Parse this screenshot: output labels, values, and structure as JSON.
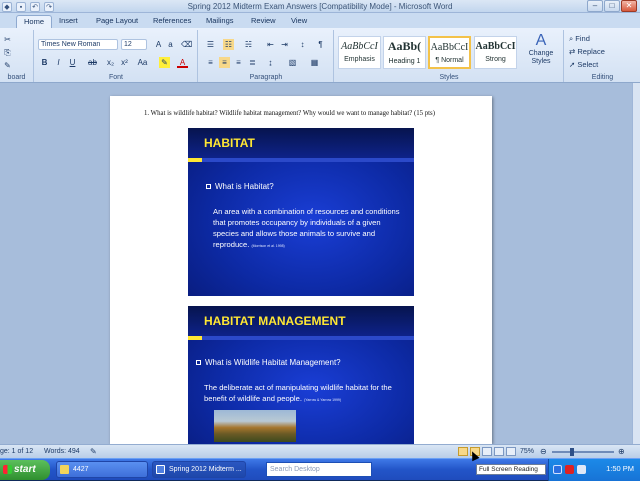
{
  "window": {
    "title": "Spring 2012 Midterm Exam Answers [Compatibility Mode] - Microsoft Word",
    "controls": [
      "–",
      "□",
      "✕"
    ]
  },
  "tabs": [
    {
      "label": "Home",
      "active": true
    },
    {
      "label": "Insert"
    },
    {
      "label": "Page Layout"
    },
    {
      "label": "References"
    },
    {
      "label": "Mailings"
    },
    {
      "label": "Review"
    },
    {
      "label": "View"
    }
  ],
  "ribbon": {
    "clipboard_label": "board",
    "font": {
      "name": "Times New Roman",
      "size": "12",
      "label": "Font"
    },
    "paragraph_label": "Paragraph",
    "styles": {
      "items": [
        {
          "sample": "AaBbCcI",
          "name": "Emphasis"
        },
        {
          "sample": "AaBb(",
          "name": "Heading 1"
        },
        {
          "sample": "AaBbCcI",
          "name": "¶ Normal",
          "selected": true
        },
        {
          "sample": "AaBbCcI",
          "name": "Strong"
        }
      ],
      "change_styles": "Change Styles",
      "label": "Styles"
    },
    "editing": {
      "find": "Find",
      "replace": "Replace",
      "select": "Select",
      "label": "Editing"
    }
  },
  "document": {
    "question": "1.   What is wildlife habitat?  Wildlife habitat management?  Why would we want to manage habitat? (15 pts)",
    "slides": [
      {
        "title": "HABITAT",
        "bullet": "What is Habitat?",
        "body": "An area with a combination of resources and conditions that promotes occupancy by individuals of a given species and allows those animals to survive and reproduce.",
        "cite": "(Morrison et al. 1998)"
      },
      {
        "title": "HABITAT MANAGEMENT",
        "bullet": "What is Wildlife Habitat Management?",
        "body": "The deliberate act of manipulating wildlife habitat for the benefit of wildlife and people.",
        "cite": "(Yarrow & Yarrow 1999)"
      }
    ]
  },
  "status": {
    "page": "ge: 1 of 12",
    "words": "Words: 494",
    "zoom": "75%"
  },
  "taskbar": {
    "start": "start",
    "items": [
      {
        "label": "4427"
      },
      {
        "label": "Spring 2012 Midterm ...",
        "active": true
      }
    ],
    "search_placeholder": "Search Desktop",
    "clock": "1:50 PM"
  },
  "tooltip": "Full Screen Reading"
}
